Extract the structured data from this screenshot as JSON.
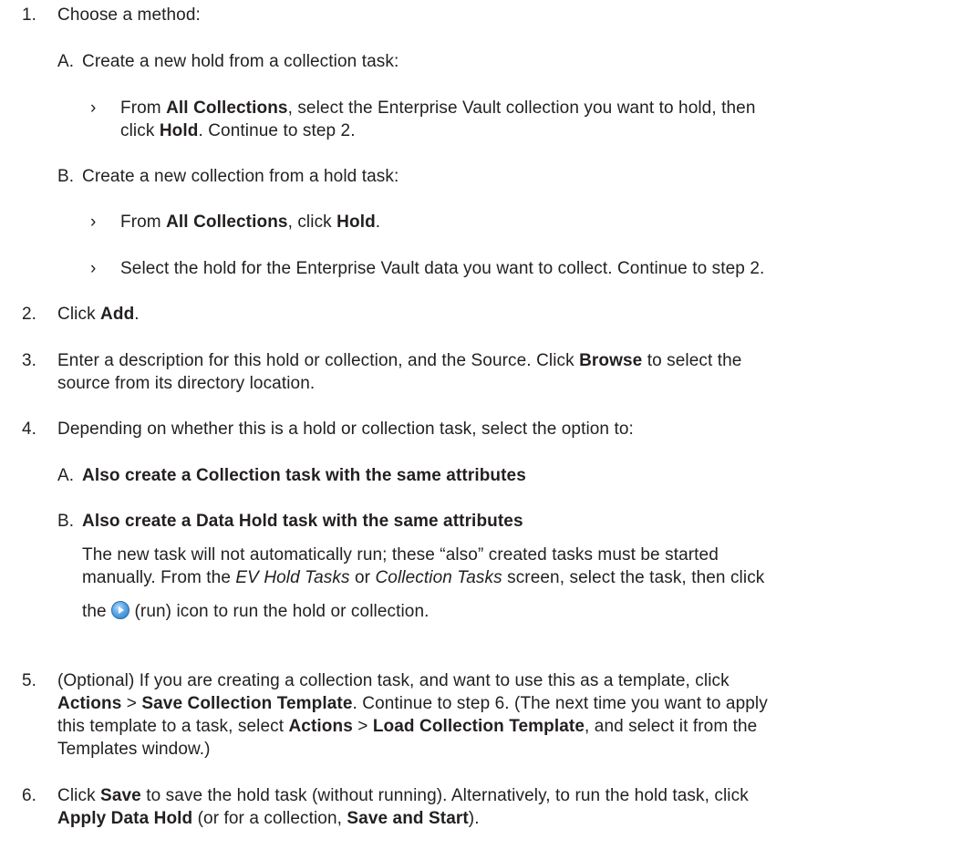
{
  "steps": [
    {
      "num": "1.",
      "text": "Choose a method:"
    },
    {
      "num": "2.",
      "pre": "Click ",
      "bold": "Add",
      "post": "."
    },
    {
      "num": "3.",
      "line1_pre": "Enter a description for this hold or collection, and the Source. Click ",
      "line1_bold": "Browse",
      "line1_post": " to select the",
      "line2": "source from its directory location."
    },
    {
      "num": "4.",
      "text": "Depending on whether this is a hold or collection task, select the option to:"
    },
    {
      "num": "5.",
      "line1": "(Optional) If you are creating a collection task, and want to use this as a template, click",
      "line2_b1": "Actions",
      "line2_sep": " > ",
      "line2_b2": "Save Collection Template",
      "line2_post": ". Continue to step 6. (The next time you want to apply",
      "line3_pre": "this template to a task, select ",
      "line3_b1": "Actions",
      "line3_sep": " > ",
      "line3_b2": "Load Collection Template",
      "line3_post": ", and select it from the",
      "line4": "Templates window.)"
    },
    {
      "num": "6.",
      "line1_pre": "Click ",
      "line1_bold": "Save",
      "line1_post": " to save the hold task (without running). Alternatively, to run the hold task, click",
      "line2_b1": "Apply Data Hold",
      "line2_mid": " (or for a collection, ",
      "line2_b2": "Save and Start",
      "line2_post": ")."
    }
  ],
  "step1_options": [
    {
      "letter": "A.",
      "text": "Create a new hold from a collection task:",
      "bullet": "›",
      "b1_pre": "From ",
      "b1_bold1": "All Collections",
      "b1_mid": ", select the Enterprise Vault collection you want to hold, then",
      "b1_l2_pre": "click ",
      "b1_l2_bold": "Hold",
      "b1_l2_post": ". Continue to step 2."
    },
    {
      "letter": "B.",
      "text": "Create a new collection from a hold task:",
      "bullet": "›",
      "b1_pre": "From ",
      "b1_bold1": "All Collections",
      "b1_mid": ", click ",
      "b1_bold2": "Hold",
      "b1_post": ".",
      "b2": "Select the hold for the Enterprise Vault data you want to collect. Continue to step 2."
    }
  ],
  "step4_options": [
    {
      "letter": "A.",
      "bold": "Also create a Collection task with the same attributes"
    },
    {
      "letter": "B.",
      "bold": "Also create a Data Hold task with the same attributes",
      "note_l1": "The new task will not automatically run; these “also” created tasks must be started",
      "note_l2_pre": "manually. From the ",
      "note_l2_i1": "EV Hold Tasks",
      "note_l2_mid": " or ",
      "note_l2_i2": "Collection Tasks",
      "note_l2_post": " screen, select the task, then click",
      "note_l3_pre": "the ",
      "icon": "run-icon",
      "note_l3_post": " (run) icon to run the hold or collection."
    }
  ]
}
